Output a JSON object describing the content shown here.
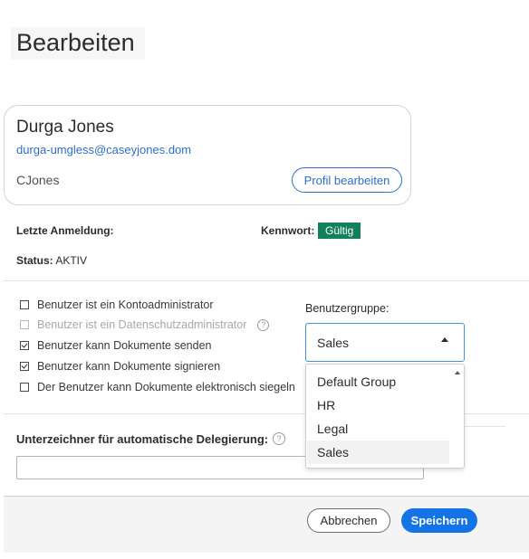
{
  "page": {
    "title": "Bearbeiten"
  },
  "profile": {
    "name": "Durga Jones",
    "email": "durga-umgless@caseyjones.dom",
    "username": "CJones",
    "edit_button": "Profil bearbeiten"
  },
  "info": {
    "last_login_label": "Letzte Anmeldung:",
    "password_label": "Kennwort:",
    "password_status": "Gültig",
    "status_label": "Status:",
    "status_value": " AKTIV"
  },
  "permissions": [
    {
      "label": "Benutzer ist ein Kontoadministrator",
      "checked": false,
      "disabled": false
    },
    {
      "label": "Benutzer ist ein Datenschutzadministrator",
      "checked": false,
      "disabled": true
    },
    {
      "label": "Benutzer kann Dokumente senden",
      "checked": true,
      "disabled": false
    },
    {
      "label": "Benutzer kann Dokumente signieren",
      "checked": true,
      "disabled": false
    },
    {
      "label": "Der Benutzer kann Dokumente elektronisch siegeln",
      "checked": false,
      "disabled": false
    }
  ],
  "group": {
    "label": "Benutzergruppe:",
    "selected": "Sales",
    "options": [
      "Default Group",
      "HR",
      "Legal",
      "Sales"
    ]
  },
  "delegation": {
    "label": "Unterzeichner für automatische Delegierung:",
    "value": ""
  },
  "footer": {
    "cancel": "Abbrechen",
    "save": "Speichern"
  },
  "colors": {
    "accent": "#1473e6",
    "link": "#2d6fd3",
    "valid_badge": "#12805c"
  },
  "icons": {
    "help": "question-circle-icon",
    "select_caret": "caret-up-icon",
    "scroll_up": "scroll-up-arrow-icon"
  }
}
